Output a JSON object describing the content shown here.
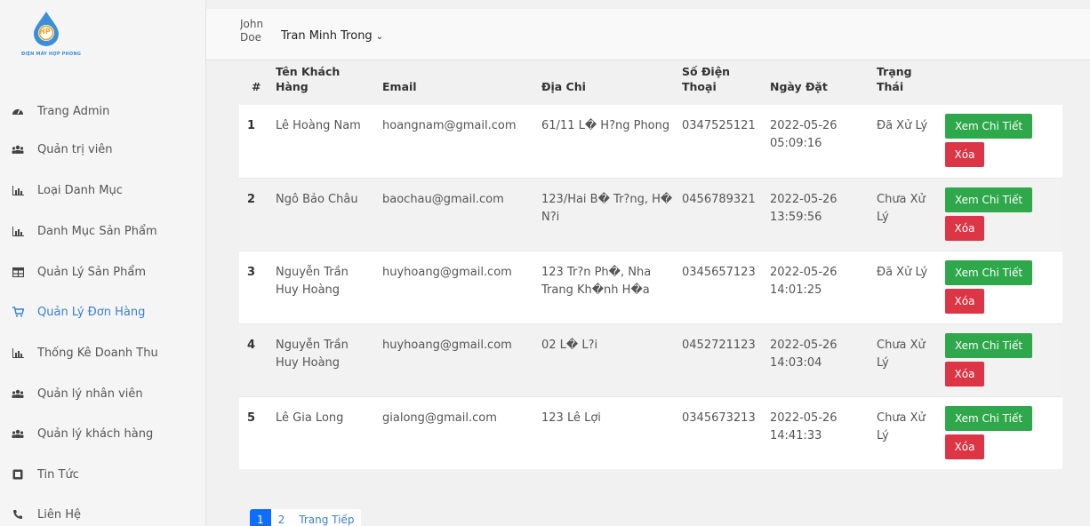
{
  "brand": {
    "logo_text": "ĐIỆN MÁY HỢP PHONG",
    "logo_letters": "HP",
    "accent": "#3a8fd8"
  },
  "header": {
    "user_first": "John Doe",
    "user_main": "Tran Minh Trong"
  },
  "sidebar": {
    "items": [
      {
        "label": "Trang Admin",
        "icon": "dashboard-icon"
      },
      {
        "label": "Quản trị viên",
        "icon": "users-icon"
      },
      {
        "label": "Loại Danh Mục",
        "icon": "chart-icon"
      },
      {
        "label": "Danh Mục Sản Phẩm",
        "icon": "chart-icon"
      },
      {
        "label": "Quản Lý Sản Phẩm",
        "icon": "table-icon"
      },
      {
        "label": "Quản Lý Đơn Hàng",
        "icon": "cart-icon",
        "active": true
      },
      {
        "label": "Thống Kê Doanh Thu",
        "icon": "chart-icon"
      },
      {
        "label": "Quản lý nhân viên",
        "icon": "users-icon"
      },
      {
        "label": "Quản lý khách hàng",
        "icon": "users-icon"
      },
      {
        "label": "Tin Tức",
        "icon": "news-icon"
      },
      {
        "label": "Liên Hệ",
        "icon": "phone-icon"
      }
    ]
  },
  "table": {
    "headers": {
      "idx": "#",
      "name": "Tên Khách Hàng",
      "email": "Email",
      "address": "Địa Chi",
      "phone": "Số Điện Thoại",
      "date": "Ngày Đặt",
      "status": "Trạng Thái"
    },
    "rows": [
      {
        "idx": "1",
        "name": "Lê Hoàng Nam",
        "email": "hoangnam@gmail.com",
        "address": "61/11 L� H?ng Phong",
        "phone": "0347525121",
        "date": "2022-05-26 05:09:16",
        "status": "Đã Xử Lý"
      },
      {
        "idx": "2",
        "name": "Ngô Bảo Châu",
        "email": "baochau@gmail.com",
        "address": "123/Hai B� Tr?ng, H� N?i",
        "phone": "0456789321",
        "date": "2022-05-26 13:59:56",
        "status": "Chưa Xử Lý"
      },
      {
        "idx": "3",
        "name": "Nguyễn Trần Huy Hoàng",
        "email": "huyhoang@gmail.com",
        "address": "123 Tr?n Ph�, Nha Trang Kh�nh H�a",
        "phone": "0345657123",
        "date": "2022-05-26 14:01:25",
        "status": "Đã Xử Lý"
      },
      {
        "idx": "4",
        "name": "Nguyễn Trần Huy Hoàng",
        "email": "huyhoang@gmail.com",
        "address": "02 L� L?i",
        "phone": "0452721123",
        "date": "2022-05-26 14:03:04",
        "status": "Chưa Xử Lý"
      },
      {
        "idx": "5",
        "name": "Lê Gia Long",
        "email": "gialong@gmail.com",
        "address": "123 Lê Lợi",
        "phone": "0345673213",
        "date": "2022-05-26 14:41:33",
        "status": "Chưa Xử Lý"
      }
    ],
    "detail_label": "Xem Chi Tiết",
    "delete_label": "Xóa"
  },
  "pagination": {
    "pages": [
      "1",
      "2"
    ],
    "next_label": "Trang Tiếp",
    "active": "1"
  },
  "colors": {
    "success": "#2ea84a",
    "danger": "#dc3545",
    "primary": "#0d6efd",
    "active_nav": "#3a7fd5"
  }
}
